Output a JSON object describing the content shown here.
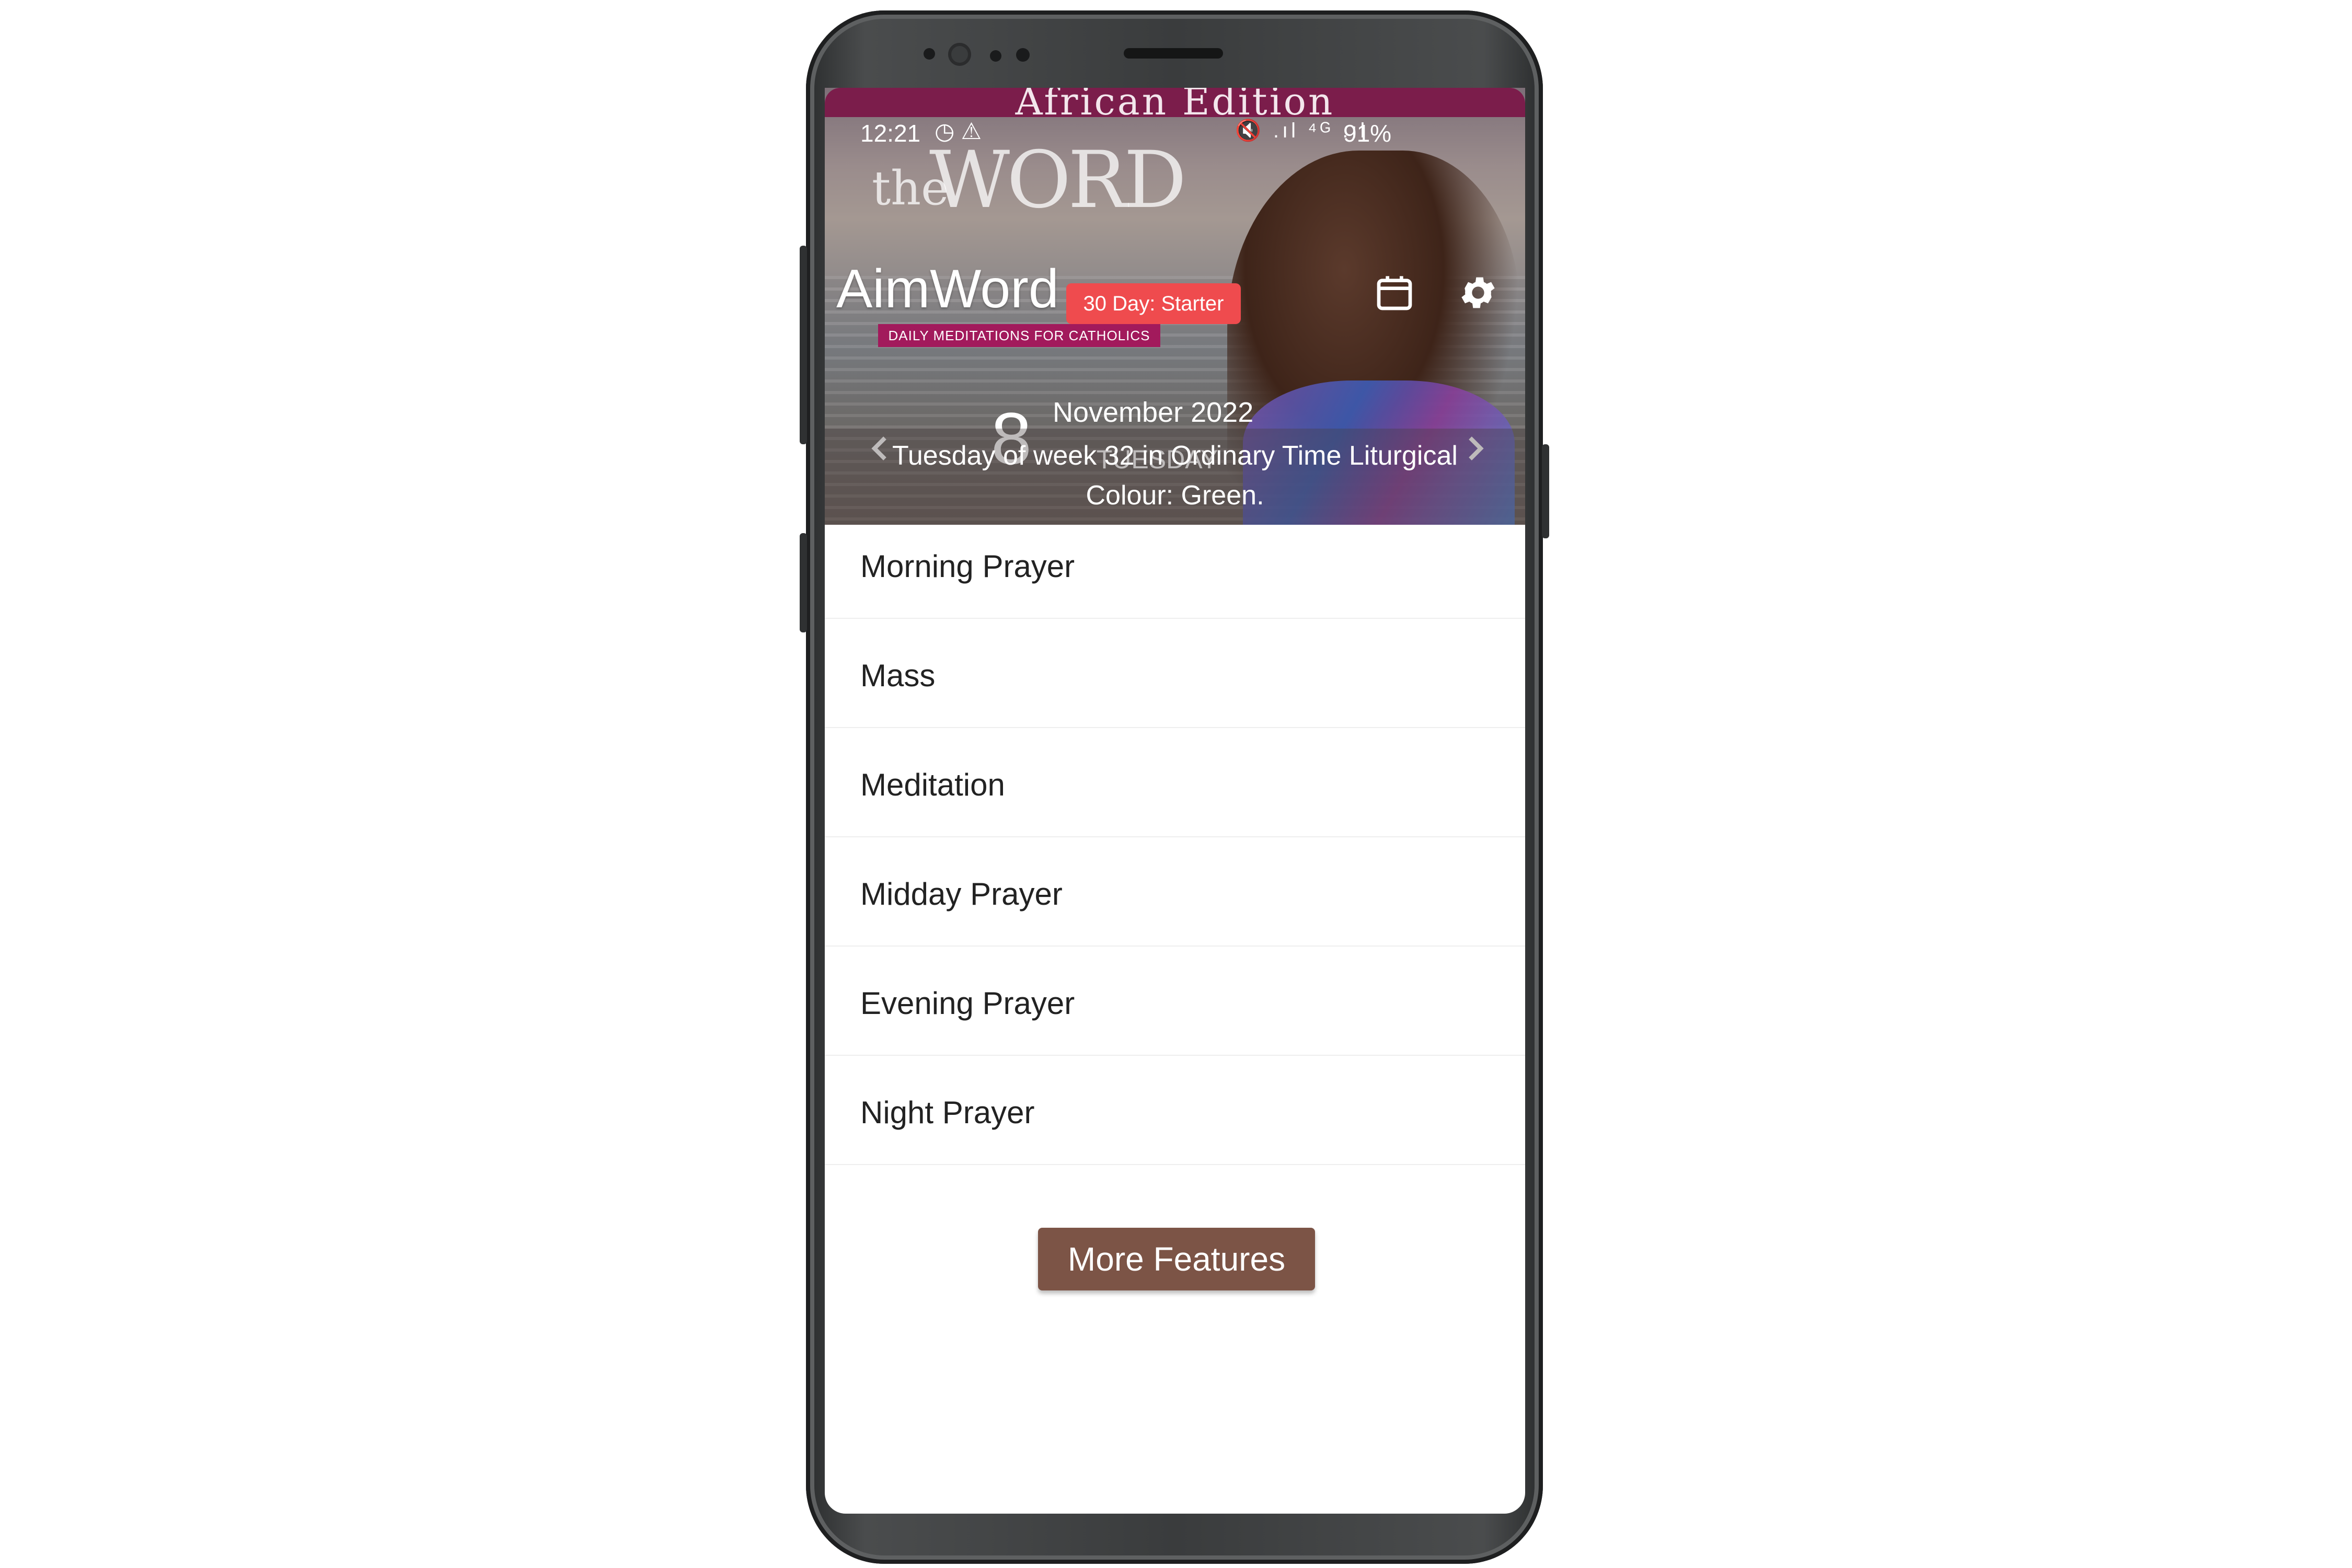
{
  "edition": "African Edition",
  "status_bar": {
    "time": "12:21",
    "left_icons": "◷ ⚠",
    "right_icons": "🔇 .ıl ⁴ᴳ .ıl",
    "battery": "91%"
  },
  "logo": {
    "the": "the",
    "word": "WORD",
    "subtitle": "DAILY MEDITATIONS FOR CATHOLICS"
  },
  "app_name": "AimWord",
  "plan_badge": "30 Day: Starter",
  "date": {
    "day": "8",
    "month_year": "November 2022",
    "weekday": "TUESDAY"
  },
  "liturgical_info": "Tuesday of week 32 in Ordinary Time Liturgical Colour: Green.",
  "menu": [
    {
      "label": "Morning Prayer"
    },
    {
      "label": "Mass"
    },
    {
      "label": "Meditation"
    },
    {
      "label": "Midday Prayer"
    },
    {
      "label": "Evening Prayer"
    },
    {
      "label": "Night Prayer"
    }
  ],
  "more_features": "More Features",
  "icons": {
    "calendar": "calendar-icon",
    "settings": "gear-icon",
    "prev": "chevron-left-icon",
    "next": "chevron-right-icon"
  },
  "colors": {
    "edition_bar": "#7b1d4b",
    "badge": "#ef4b4e",
    "more_button": "#7c5446"
  }
}
